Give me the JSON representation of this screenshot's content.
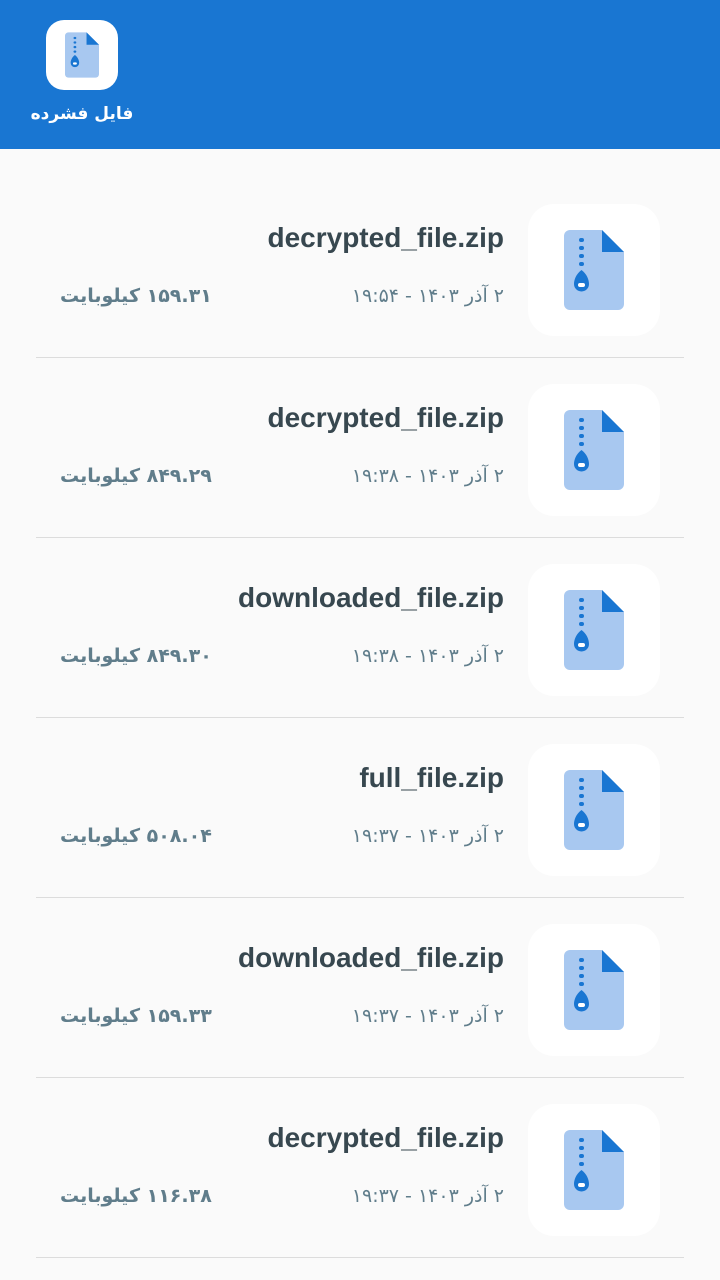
{
  "header": {
    "tab_label": "فایل فشرده",
    "tab_icon": "zip-file-icon",
    "background_color": "#1976d2"
  },
  "files": [
    {
      "name": "decrypted_file.zip",
      "date": "۲ آذر ۱۴۰۳ - ۱۹:۵۴",
      "size": "۱۵۹.۳۱ کیلوبایت",
      "icon": "zip-file-icon"
    },
    {
      "name": "decrypted_file.zip",
      "date": "۲ آذر ۱۴۰۳ - ۱۹:۳۸",
      "size": "۸۴۹.۲۹ کیلوبایت",
      "icon": "zip-file-icon"
    },
    {
      "name": "downloaded_file.zip",
      "date": "۲ آذر ۱۴۰۳ - ۱۹:۳۸",
      "size": "۸۴۹.۳۰ کیلوبایت",
      "icon": "zip-file-icon"
    },
    {
      "name": "full_file.zip",
      "date": "۲ آذر ۱۴۰۳ - ۱۹:۳۷",
      "size": "۵۰۸.۰۴ کیلوبایت",
      "icon": "zip-file-icon"
    },
    {
      "name": "downloaded_file.zip",
      "date": "۲ آذر ۱۴۰۳ - ۱۹:۳۷",
      "size": "۱۵۹.۳۳ کیلوبایت",
      "icon": "zip-file-icon"
    },
    {
      "name": "decrypted_file.zip",
      "date": "۲ آذر ۱۴۰۳ - ۱۹:۳۷",
      "size": "۱۱۶.۳۸ کیلوبایت",
      "icon": "zip-file-icon"
    }
  ]
}
